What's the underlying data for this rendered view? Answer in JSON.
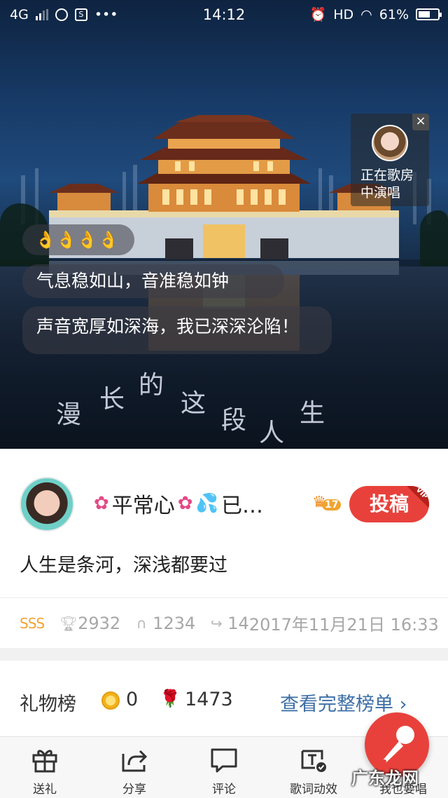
{
  "status_bar": {
    "network": "4G",
    "time": "14:12",
    "hd": "HD",
    "battery": "61%",
    "battery_level": 0.61
  },
  "video": {
    "singer_card": {
      "line1": "正在歌房",
      "line2": "中演唱",
      "close": "×"
    },
    "comments": [
      {
        "text": "👌👌👌👌"
      },
      {
        "text": "气息稳如山，音准稳如钟"
      },
      {
        "text": "声音宽厚如深海，我已深深沦陷！"
      }
    ],
    "lyrics": [
      "漫",
      "长",
      "的",
      "这",
      "段",
      "人",
      "生"
    ]
  },
  "song_info": {
    "username": "平常心",
    "username_suffix": "已…",
    "level": "17",
    "submit_label": "投稿",
    "vip_badge": "VIP",
    "description": "人生是条河，深浅都要过"
  },
  "stats": {
    "rating": "SSS",
    "trophies": "2932",
    "listens": "1234",
    "shares": "14",
    "date": "2017年11月21日 16:33"
  },
  "gift_board": {
    "title": "礼物榜",
    "coins": "0",
    "flowers": "1473",
    "link": "查看完整榜单",
    "chevron": "›"
  },
  "toolbar": {
    "items": [
      {
        "label": "送礼",
        "icon": "gift-icon"
      },
      {
        "label": "分享",
        "icon": "share-icon"
      },
      {
        "label": "评论",
        "icon": "comment-icon"
      },
      {
        "label": "歌词动效",
        "icon": "lyrics-effect-icon"
      },
      {
        "label": "我也要唱",
        "icon": "mic-icon"
      }
    ]
  },
  "watermark": "广东龙网",
  "colors": {
    "accent": "#e8413b",
    "link": "#3d6fa6",
    "rating": "#f0a431"
  }
}
